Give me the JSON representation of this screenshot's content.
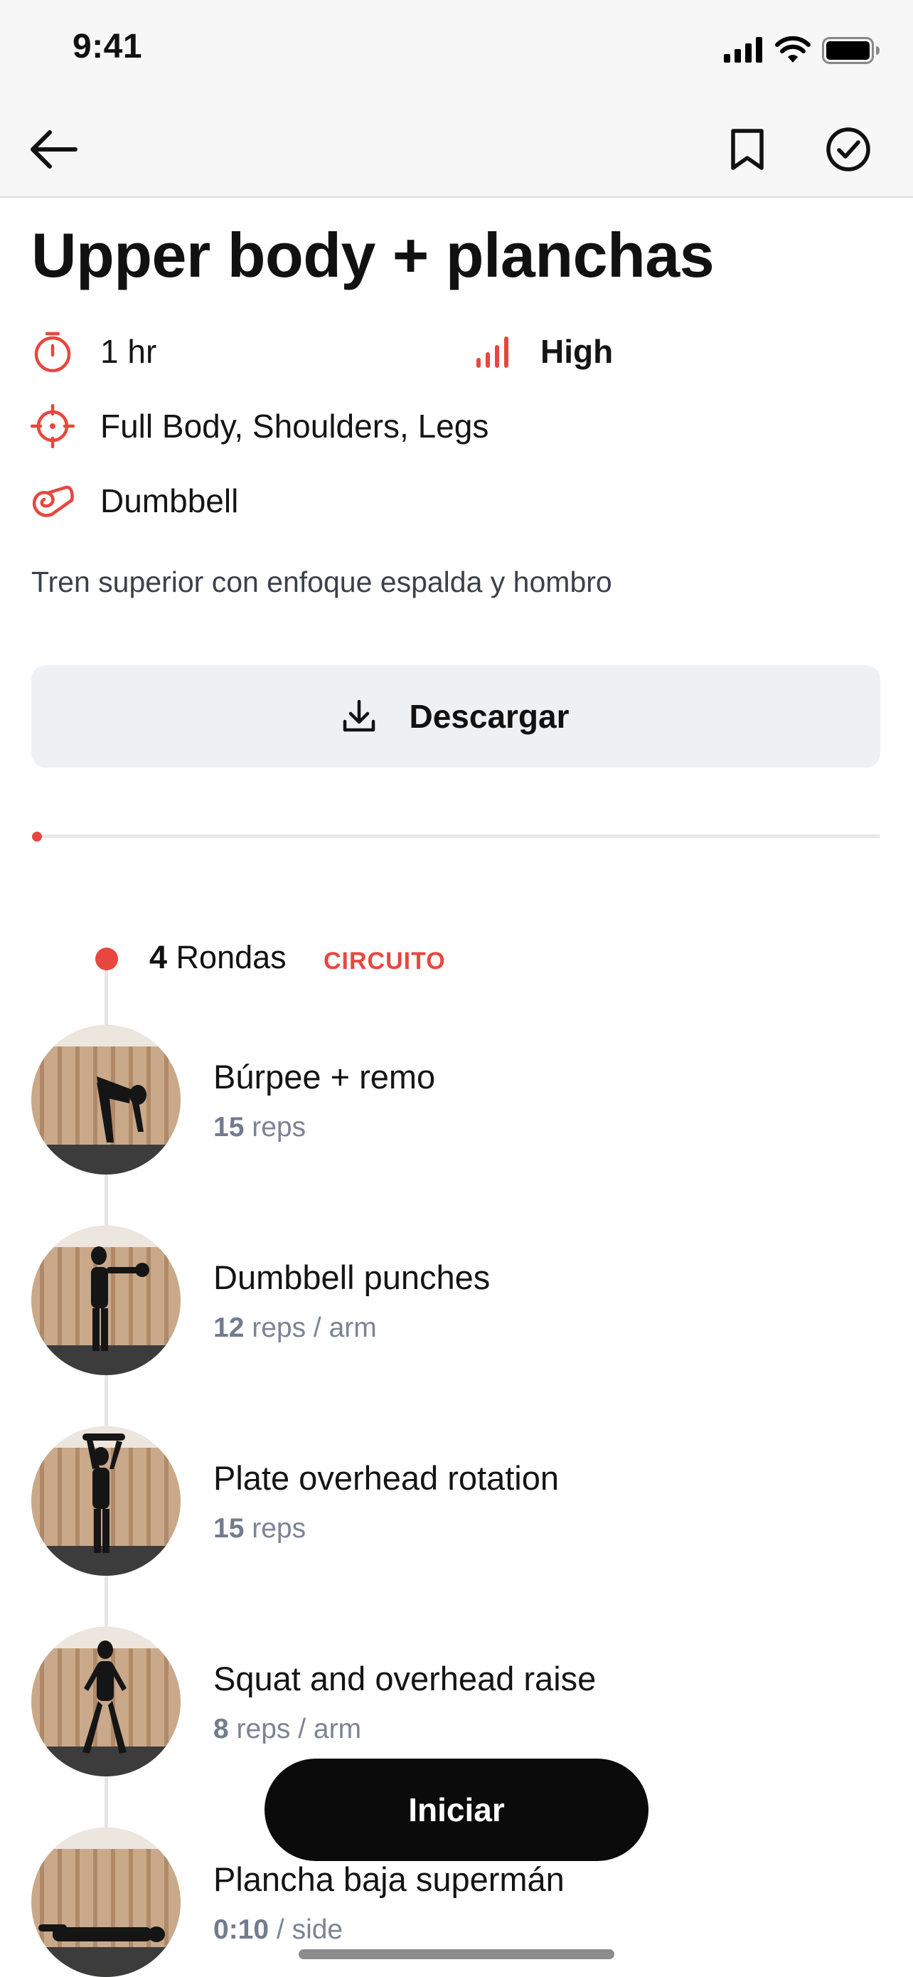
{
  "status_bar": {
    "time": "9:41"
  },
  "nav": {
    "back_icon": "arrow-left-icon",
    "bookmark_icon": "bookmark-icon",
    "complete_icon": "check-circle-icon"
  },
  "workout": {
    "title": "Upper body + planchas",
    "duration": "1 hr",
    "intensity": "High",
    "targets": "Full Body, Shoulders, Legs",
    "equipment": "Dumbbell",
    "description": "Tren superior con enfoque espalda y hombro"
  },
  "download": {
    "label": "Descargar",
    "icon": "download-icon"
  },
  "progress": {
    "fraction": 0.0
  },
  "circuit": {
    "rounds_count": "4",
    "rounds_label": "Rondas",
    "tag": "CIRCUITO"
  },
  "exercises": [
    {
      "name": "Búrpee + remo",
      "count": "15",
      "unit": "reps"
    },
    {
      "name": "Dumbbell punches",
      "count": "12",
      "unit": "reps / arm"
    },
    {
      "name": "Plate overhead rotation",
      "count": "15",
      "unit": "reps"
    },
    {
      "name": "Squat and overhead raise",
      "count": "8",
      "unit": "reps / arm"
    },
    {
      "name": "Plancha baja supermán",
      "count": "0:10",
      "unit": "/ side"
    }
  ],
  "start_button": {
    "label": "Iniciar"
  },
  "colors": {
    "accent": "#e8473e",
    "button_dark": "#0b0b0b",
    "download_bg": "#eef1f4",
    "muted_text": "#7b8494"
  }
}
